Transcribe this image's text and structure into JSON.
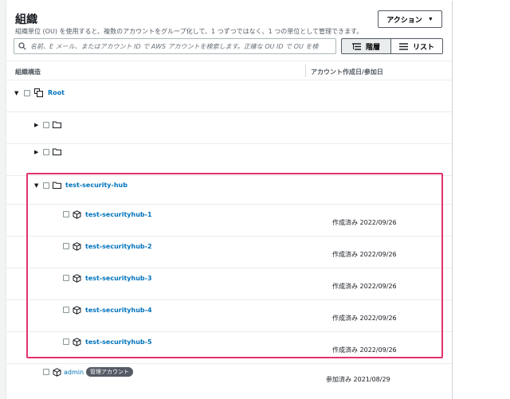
{
  "header": {
    "title": "組織",
    "description": "組織単位 (OU) を使用すると、複数のアカウントをグループ化して、1 つずつではなく、1 つの単位として管理できます。",
    "action_label": "アクション"
  },
  "search": {
    "placeholder": "名前、E メール、またはアカウント ID で AWS アカウントを検索します。正確な OU ID で OU を検"
  },
  "view_toggle": {
    "hierarchy_label": "階層",
    "list_label": "リスト",
    "selected": "hierarchy"
  },
  "table": {
    "col_structure": "組織構造",
    "col_date": "アカウント作成日/参加日"
  },
  "tree": {
    "root_label": "Root",
    "ou_selected": "test-security-hub",
    "accounts": [
      {
        "name": "test-securityhub-1",
        "date": "作成済み 2022/09/26"
      },
      {
        "name": "test-securityhub-2",
        "date": "作成済み 2022/09/26"
      },
      {
        "name": "test-securityhub-3",
        "date": "作成済み 2022/09/26"
      },
      {
        "name": "test-securityhub-4",
        "date": "作成済み 2022/09/26"
      },
      {
        "name": "test-securityhub-5",
        "date": "作成済み 2022/09/26"
      }
    ],
    "admin": {
      "name": "admin",
      "badge": "管理アカウント",
      "date": "参加済み 2021/08/29"
    }
  },
  "icons": {
    "search": "search-icon",
    "caret": "caret-down-icon",
    "hierarchy": "hierarchy-icon",
    "list": "list-icon",
    "root": "root-icon",
    "folder": "folder-icon",
    "account": "account-cube-icon"
  },
  "colors": {
    "link": "#0073bb",
    "highlight": "#e3336b",
    "badge": "#545b64"
  }
}
